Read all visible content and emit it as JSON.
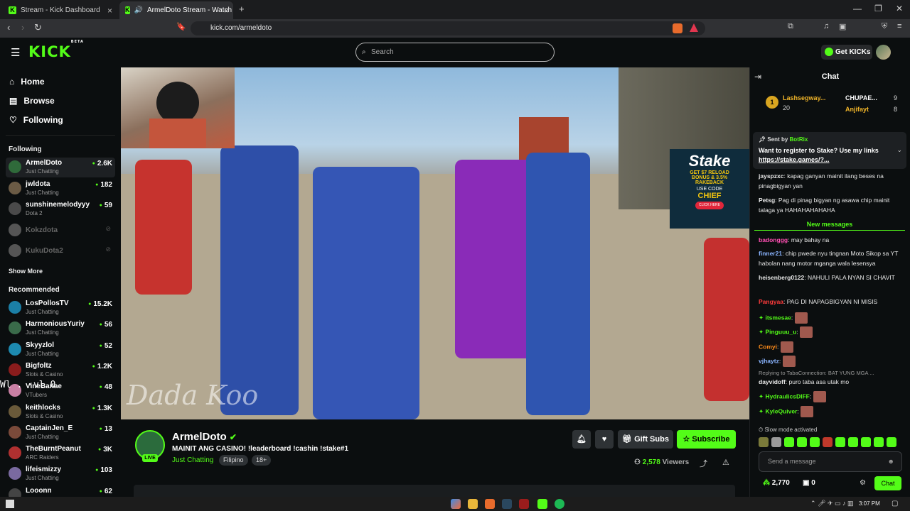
{
  "browser": {
    "tabs": [
      {
        "title": "Stream - Kick Dashboard"
      },
      {
        "title": "ArmelDoto Stream - Watch Li"
      }
    ],
    "new_tab": "+",
    "url": "kick.com/armeldoto"
  },
  "header": {
    "logo": "KICK",
    "beta": "BETA",
    "search_placeholder": "Search",
    "get_kicks": "Get KICKs"
  },
  "nav": {
    "items": [
      "Home",
      "Browse",
      "Following"
    ]
  },
  "following": {
    "heading": "Following",
    "channels": [
      {
        "name": "ArmelDoto",
        "category": "Just Chatting",
        "viewers": "2.6K",
        "color": "#2f6a3a"
      },
      {
        "name": "jwldota",
        "category": "Just Chatting",
        "viewers": "182",
        "color": "#6b5b45"
      },
      {
        "name": "sunshinemelodyyy",
        "category": "Dota 2",
        "viewers": "59",
        "color": "#4a4a4a"
      },
      {
        "name": "Kokzdota",
        "category": "",
        "viewers": "",
        "color": "#555"
      },
      {
        "name": "KukuDota2",
        "category": "",
        "viewers": "",
        "color": "#555"
      }
    ],
    "show_more": "Show More"
  },
  "recommended": {
    "heading": "Recommended",
    "channels": [
      {
        "name": "LosPollosTV",
        "category": "Just Chatting",
        "viewers": "15.2K",
        "color": "#1b7fa6"
      },
      {
        "name": "HarmoniousYuriy",
        "category": "Just Chatting",
        "viewers": "56",
        "color": "#3a6b4a"
      },
      {
        "name": "Skyyzlol",
        "category": "Just Chatting",
        "viewers": "52",
        "color": "#1d8ab0"
      },
      {
        "name": "Bigfoltz",
        "category": "Slots & Casino",
        "viewers": "1.2K",
        "color": "#8a1c1c"
      },
      {
        "name": "VineBanae",
        "category": "VTubers",
        "viewers": "48",
        "color": "#c97fa4"
      },
      {
        "name": "keithlocks",
        "category": "Slots & Casino",
        "viewers": "1.3K",
        "color": "#6a5a3a"
      },
      {
        "name": "CaptainJen_E",
        "category": "Just Chatting",
        "viewers": "13",
        "color": "#7a4a3a"
      },
      {
        "name": "TheBurntPeanut",
        "category": "ARC Raiders",
        "viewers": "3K",
        "color": "#b03030"
      },
      {
        "name": "lifeismizzy",
        "category": "Just Chatting",
        "viewers": "103",
        "color": "#7a6aa0"
      },
      {
        "name": "Looonn",
        "category": "",
        "viewers": "62",
        "color": "#444"
      }
    ]
  },
  "overlay_text": "Wl  . ·vl  0",
  "video": {
    "watermark": "Dada Koo",
    "ad": {
      "brand": "Stake",
      "line1": "GET $7 RELOAD",
      "line2": "BONUS & 3.5%",
      "line3": "RAKEBACK",
      "line4": "USE CODE",
      "code": "CHIEF",
      "cta": "CLICK HERE"
    }
  },
  "stream": {
    "name": "ArmelDoto",
    "title": "MAINIT ANG CASINO! !leaderboard !cashin !stake#1",
    "category": "Just Chatting",
    "tags": [
      "Filipino",
      "18+"
    ],
    "live": "LIVE",
    "viewers": "2,578",
    "viewers_label": "Viewers",
    "gift_subs": "Gift Subs",
    "subscribe": "Subscribe"
  },
  "chat": {
    "title": "Chat",
    "leaderboard": [
      {
        "rank": "1",
        "name": "Lashsegway...",
        "count": "20"
      },
      {
        "name": "CHUPAE...",
        "count": "9"
      },
      {
        "name": "Anjifayt",
        "count": "8"
      }
    ],
    "pinned": {
      "sent_by": "Sent by",
      "bot": "BotRix",
      "text": "Want to register to Stake? Use my links",
      "link": "https://stake.games/?..."
    },
    "messages_old": [
      {
        "user": "jayspzxc",
        "text": "kapag ganyan mainit ilang beses na pinagbigyan yan",
        "color": "#e8e8e8"
      },
      {
        "user": "Petsg",
        "text": "Pag di pinag bigyan ng asawa chip mainit talaga ya HAHAHAHAHAHA",
        "color": "#e8e8e8"
      }
    ],
    "new_messages": "New messages",
    "messages": [
      {
        "user": "badonggg",
        "text": "may bahay na",
        "color": "#ff4fb3"
      },
      {
        "user": "finner21",
        "text": "chip pwede nyu tingnan Moto Sikop sa YT habolan nang motor mganga wala lesensya",
        "color": "#8ab4ff"
      },
      {
        "user": "heisenberg0122",
        "text": "NAHULI PALA NYAN SI CHAVIT",
        "color": "#e8e8e8"
      },
      {
        "user": "Pangyaa",
        "text": "PAG DI NAPAGBIGYAN NI MISIS",
        "color": "#ff3b3b"
      },
      {
        "user": "itsmesae",
        "text": "",
        "color": "#53fc18"
      },
      {
        "user": "Pinguuu_u",
        "text": "",
        "color": "#53fc18"
      },
      {
        "user": "Comyi",
        "text": "",
        "color": "#ff8c1a"
      },
      {
        "user": "vjhaytz",
        "text": "",
        "color": "#8ab4ff"
      },
      {
        "reply": "Replying to TabaConnection: BAT YUNG MGA ...",
        "user": "dayvidoff",
        "text": "puro taba asa utak mo",
        "color": "#e8e8e8"
      },
      {
        "user": "HydraulicsDIFF",
        "text": "",
        "color": "#53fc18"
      },
      {
        "user": "KyleQuiver",
        "text": "",
        "color": "#53fc18"
      }
    ],
    "slow_mode": "Slow mode activated",
    "input_placeholder": "Send a message",
    "points": "2,770",
    "other": "0",
    "send": "Chat"
  },
  "taskbar": {
    "time": "3:07 PM"
  },
  "colors": {
    "accent": "#53fc18",
    "bg": "#0b0e0f"
  }
}
